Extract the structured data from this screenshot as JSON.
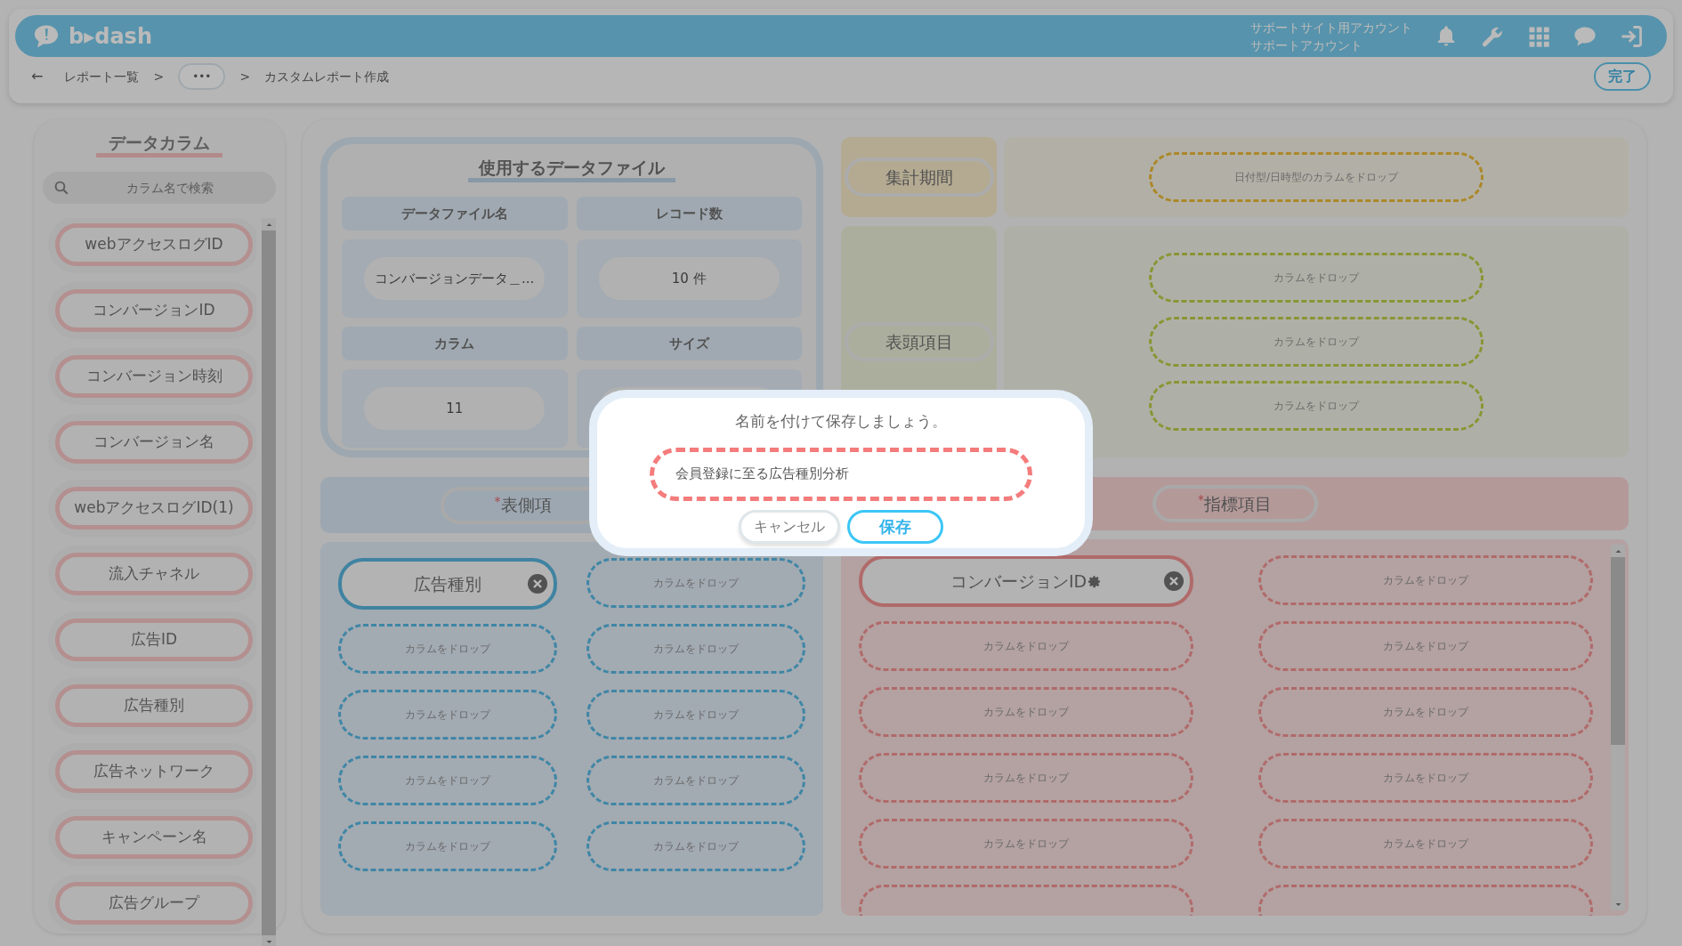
{
  "header": {
    "logo": "b▸dash",
    "account": [
      "サポートサイト用アカウント",
      "サポートアカウント"
    ]
  },
  "breadcrumb": {
    "back": "←",
    "items": [
      {
        "kind": "link",
        "text": "レポート一覧"
      },
      {
        "kind": "sep",
        "text": ">"
      },
      {
        "kind": "more",
        "text": "•••"
      },
      {
        "kind": "sep",
        "text": ">"
      },
      {
        "kind": "current",
        "text": "カスタムレポート作成"
      }
    ],
    "done": "完了"
  },
  "sidebar": {
    "title": "データカラム",
    "search": {
      "placeholder": "カラム名で検索"
    },
    "items": [
      "webアクセスログID",
      "コンバージョンID",
      "コンバージョン時刻",
      "コンバージョン名",
      "webアクセスログID(1)",
      "流入チャネル",
      "広告ID",
      "広告種別",
      "広告ネットワーク",
      "キャンペーン名",
      "広告グループ"
    ]
  },
  "data_file": {
    "title": "使用するデータファイル",
    "fields": [
      {
        "label": "データファイル名",
        "value": "コンバージョンデータ＿..."
      },
      {
        "label": "レコード数",
        "value": "10 件"
      },
      {
        "label": "カラム",
        "value": "11"
      },
      {
        "label": "サイズ"
      }
    ]
  },
  "period": {
    "label": "集計期間",
    "drop": "日付型/日時型のカラムをドロップ"
  },
  "column_headers": {
    "label": "表頭項目",
    "drops": [
      "カラムをドロップ",
      "カラムをドロップ",
      "カラムをドロップ"
    ]
  },
  "row_headers": {
    "label": "表側項",
    "required_mark": "*",
    "items": [
      {
        "kind": "column",
        "text": "広告種別",
        "gear": false
      },
      {
        "kind": "drop",
        "text": "カラムをドロップ"
      },
      {
        "kind": "drop",
        "text": "カラムをドロップ"
      },
      {
        "kind": "drop",
        "text": "カラムをドロップ"
      },
      {
        "kind": "drop",
        "text": "カラムをドロップ"
      },
      {
        "kind": "drop",
        "text": "カラムをドロップ"
      },
      {
        "kind": "drop",
        "text": "カラムをドロップ"
      },
      {
        "kind": "drop",
        "text": "カラムをドロップ"
      },
      {
        "kind": "drop",
        "text": "カラムをドロップ"
      },
      {
        "kind": "drop",
        "text": "カラムをドロップ"
      }
    ]
  },
  "metrics": {
    "label": "指標項目",
    "required_mark": "*",
    "items": [
      {
        "kind": "column",
        "text": "コンバージョンID",
        "gear": true
      },
      {
        "kind": "drop",
        "text": "カラムをドロップ"
      },
      {
        "kind": "drop",
        "text": "カラムをドロップ"
      },
      {
        "kind": "drop",
        "text": "カラムをドロップ"
      },
      {
        "kind": "drop",
        "text": "カラムをドロップ"
      },
      {
        "kind": "drop",
        "text": "カラムをドロップ"
      },
      {
        "kind": "drop",
        "text": "カラムをドロップ"
      },
      {
        "kind": "drop",
        "text": "カラムをドロップ"
      },
      {
        "kind": "drop",
        "text": "カラムをドロップ"
      },
      {
        "kind": "drop",
        "text": "カラムをドロップ"
      },
      {
        "kind": "cut"
      },
      {
        "kind": "cut"
      }
    ]
  },
  "dialog": {
    "message": "名前を付けて保存しましょう。",
    "value": "会員登録に至る広告種別分析",
    "buttons": [
      {
        "kind": "cancel",
        "text": "キャンセル"
      },
      {
        "kind": "primary",
        "text": "保存"
      }
    ]
  }
}
